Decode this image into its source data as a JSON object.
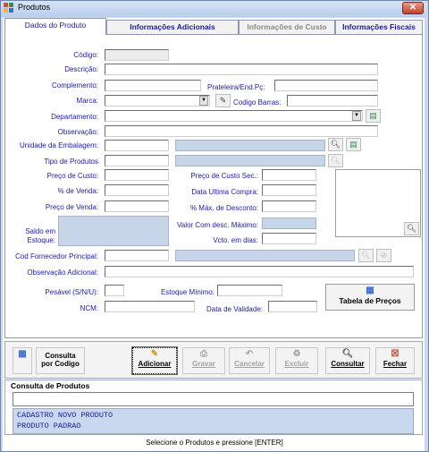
{
  "window": {
    "title": "Produtos",
    "close_glyph": "✕"
  },
  "tabs": [
    {
      "label": "Dados do Produto",
      "state": "active"
    },
    {
      "label": "Informações Adicionais",
      "state": "normal"
    },
    {
      "label": "Informações de Custo",
      "state": "disabled"
    },
    {
      "label": "Informações Fiscais",
      "state": "normal"
    }
  ],
  "form": {
    "codigo": {
      "label": "Código:",
      "value": ""
    },
    "descricao": {
      "label": "Descrição:",
      "value": ""
    },
    "complemento": {
      "label": "Complemento:",
      "value": ""
    },
    "prateleira": {
      "label": "Prateleira/End.Pç:",
      "value": ""
    },
    "marca": {
      "label": "Marca:",
      "value": ""
    },
    "codigo_barras": {
      "label": "Codigo Barras:",
      "value": ""
    },
    "departamento": {
      "label": "Departamento:",
      "value": ""
    },
    "observacao": {
      "label": "Observação:",
      "value": ""
    },
    "unidade_embalagem": {
      "label": "Unidade da Embalagem:",
      "value": "",
      "desc": ""
    },
    "tipo_produtos": {
      "label": "Tipo de Produtos",
      "value": "",
      "desc": ""
    },
    "preco_custo": {
      "label": "Preço de Custo:",
      "value": ""
    },
    "preco_custo_sec": {
      "label": "Preço de Custo Sec.:",
      "value": ""
    },
    "pct_venda": {
      "label": "% de Venda:",
      "value": ""
    },
    "data_ultima_compra": {
      "label": "Data Ultima Compra:",
      "value": ""
    },
    "preco_venda": {
      "label": "Preço de Venda:",
      "value": ""
    },
    "pct_max_desconto": {
      "label": "% Máx. de Desconto:",
      "value": ""
    },
    "saldo_estoque": {
      "label_line1": "Saldo em",
      "label_line2": "Estoque:",
      "value": ""
    },
    "valor_com_desc": {
      "label": "Valor Com desc. Máximo:",
      "value": ""
    },
    "vcto_dias": {
      "label": "Vcto. em dias:",
      "value": ""
    },
    "cod_fornecedor": {
      "label": "Cod Fornecedor Principal:",
      "value": "",
      "desc": ""
    },
    "observacao_adicional": {
      "label": "Observação Adicional:",
      "value": ""
    },
    "pesavel": {
      "label": "Pesável (S/N/U):",
      "value": ""
    },
    "estoque_minimo": {
      "label": "Estoque Mínimo:",
      "value": ""
    },
    "ncm": {
      "label": "NCM:",
      "value": ""
    },
    "data_validade": {
      "label": "Data de Validade:",
      "value": ""
    },
    "tabela_precos_label": "Tabela de Preços"
  },
  "toolbar": {
    "consulta_codigo_line1": "Consulta",
    "consulta_codigo_line2": "por Codigo",
    "adicionar": "Adicionar",
    "gravar": "Gravar",
    "cancelar": "Cancelar",
    "excluir": "Excluir",
    "consultar": "Consultar",
    "fechar": "Fechar"
  },
  "consulta": {
    "title": "Consulta de Produtos",
    "search_value": "",
    "results": [
      "CADASTRO NOVO PRODUTO",
      "PRODUTO PADRAO"
    ]
  },
  "status": {
    "text": "Selecione o Produtos e pressione [ENTER]"
  },
  "colors": {
    "accent": "#1a1ab0",
    "window_frame": "#c9d8ee",
    "readonly_field": "#c6d6e8",
    "close_button": "#c0432a"
  },
  "icons": [
    "app-icon",
    "close-icon",
    "search-icon",
    "add-record-icon",
    "grid-icon",
    "edit-icon",
    "save-icon",
    "undo-icon",
    "recycle-icon",
    "delete-icon"
  ]
}
